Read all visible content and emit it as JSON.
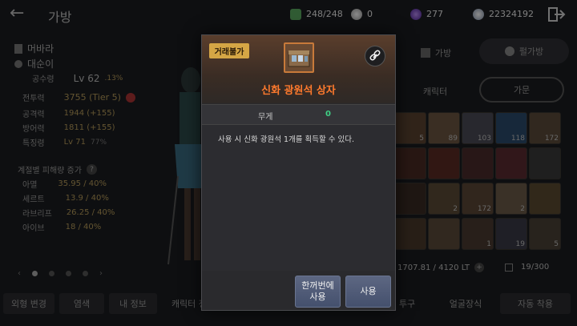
{
  "header": {
    "title": "가방",
    "resources": [
      {
        "icon": "weight-box-icon",
        "value": "248/248",
        "color": "#5aa860"
      },
      {
        "icon": "pearl-icon",
        "value": "0",
        "color": "#cfcfcf"
      },
      {
        "icon": "dark-orb-icon",
        "value": "277",
        "color": "#7a3fd0"
      },
      {
        "icon": "silver-coin-icon",
        "value": "22324192",
        "color": "#c0c8d8"
      }
    ]
  },
  "character": {
    "family_name": "머바라",
    "char_name": "대순이",
    "level_label": "공수령",
    "level_value": "Lv 62",
    "level_pct": ".13%",
    "stats": [
      {
        "label": "전투력",
        "value": "3755 (Tier 5)"
      },
      {
        "label": "공격력",
        "value": "1944 (+155)"
      },
      {
        "label": "방어력",
        "value": "1811 (+155)"
      },
      {
        "label": "특징령",
        "value": "Lv 71",
        "extra": "77%"
      }
    ],
    "season_title": "계절별 피해량 증가",
    "seasons": [
      {
        "label": "아멸",
        "value": "35.95 / 40%"
      },
      {
        "label": "세르트",
        "value": "13.9 / 40%"
      },
      {
        "label": "라브리프",
        "value": "26.25 / 40%"
      },
      {
        "label": "아이브",
        "value": "18 / 40%"
      }
    ]
  },
  "right_panel": {
    "tab_bag": "가방",
    "tab_pearl": "펄가방",
    "tab_character": "캐릭터",
    "tab_family": "가문",
    "weight_text": "1707.81 / 4120 LT",
    "slots_text": "19/300",
    "slot_numbers": [
      "5",
      "89",
      "103",
      "118",
      "172",
      "",
      "",
      "",
      "",
      "",
      "",
      "2",
      "172",
      "2",
      "",
      "",
      "",
      "1",
      "19",
      "5"
    ]
  },
  "bottom": {
    "btn1": "외형 변경",
    "btn2": "염색",
    "btn3": "내 정보",
    "btn4": "캐릭터 정보",
    "btn5": "투구",
    "btn6": "얼굴장식",
    "btn7": "자동 착용"
  },
  "modal": {
    "tag": "거래불가",
    "item_name": "신화 광원석 상자",
    "weight_label": "무게",
    "weight_value": "0",
    "description": "사용 시 신화 광원석 1개를 획득할 수 있다.",
    "btn_use_all_line1": "한꺼번에",
    "btn_use_all_line2": "사용",
    "btn_use": "사용"
  }
}
